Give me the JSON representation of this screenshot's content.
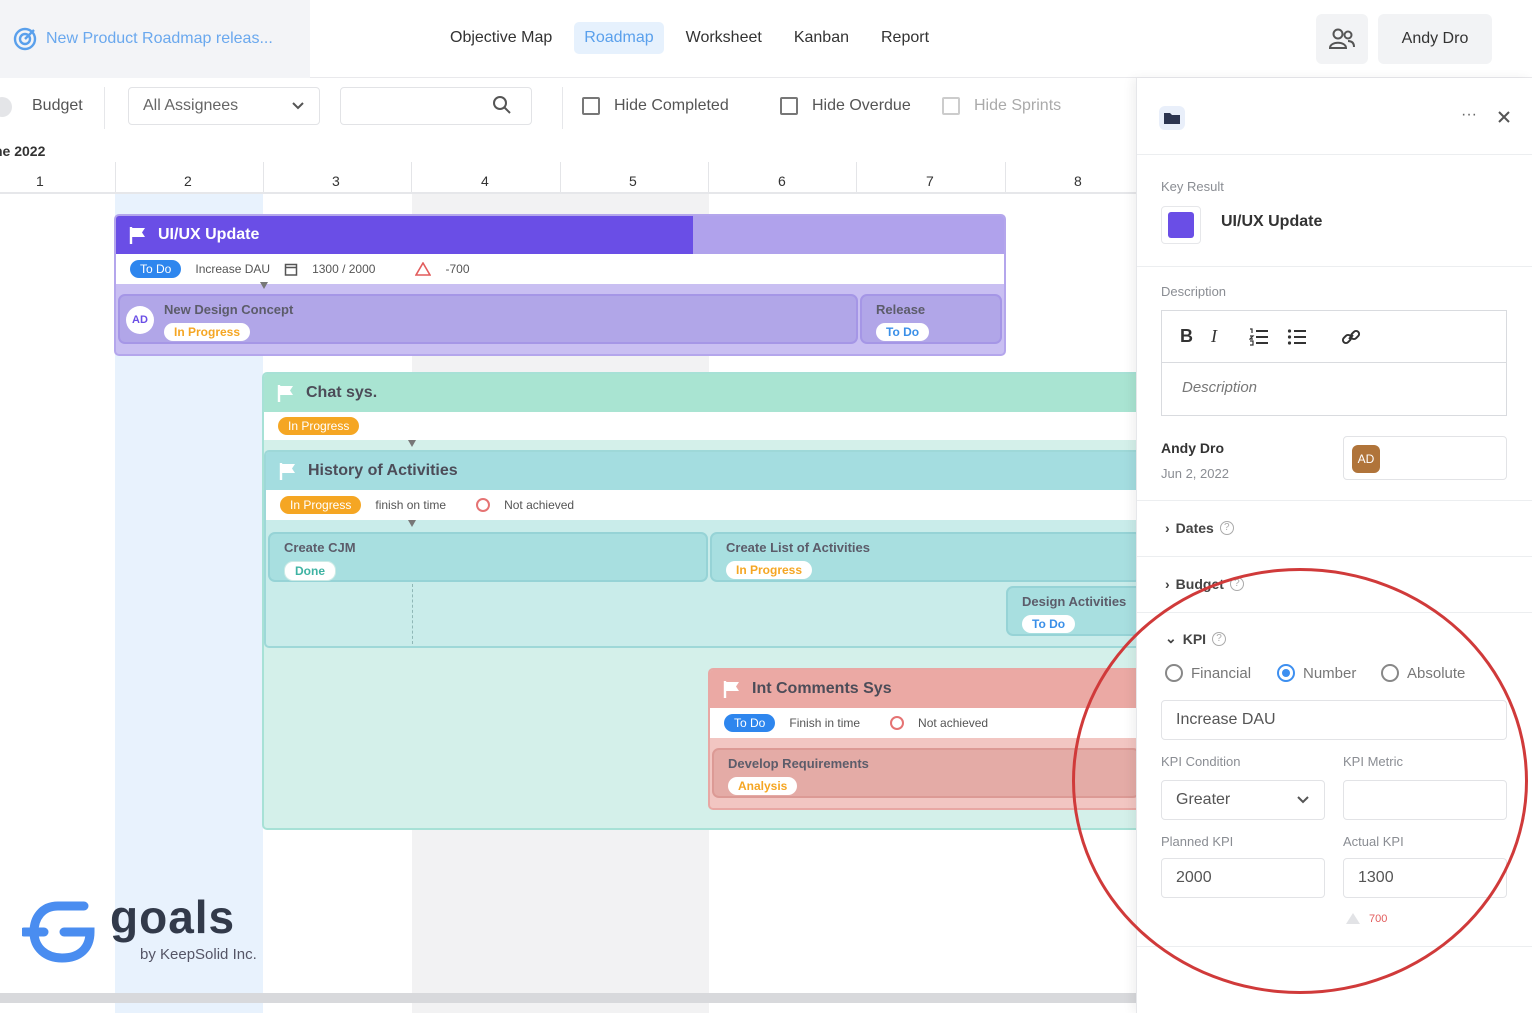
{
  "header": {
    "project_title": "New Product Roadmap releas...",
    "tabs": [
      {
        "label": "Objective Map"
      },
      {
        "label": "Roadmap",
        "active": true
      },
      {
        "label": "Worksheet"
      },
      {
        "label": "Kanban"
      },
      {
        "label": "Report"
      }
    ],
    "user_name": "Andy Dro"
  },
  "toolbar": {
    "budget_label": "Budget",
    "assignees_value": "All Assignees",
    "search_value": "",
    "hide_completed": "Hide Completed",
    "hide_overdue": "Hide Overdue",
    "hide_sprints": "Hide Sprints"
  },
  "timeline": {
    "month_label": "ne 2022",
    "columns": [
      "1",
      "2",
      "3",
      "4",
      "5",
      "6",
      "7",
      "8"
    ]
  },
  "objectives": {
    "uiux": {
      "title": "UI/UX Update",
      "status": "To Do",
      "kpi_name": "Increase DAU",
      "kpi_progress": "1300 / 2000",
      "kpi_diff": "-700",
      "progress": 0.65,
      "tasks": [
        {
          "avatar": "AD",
          "title": "New Design Concept",
          "status": "In Progress"
        },
        {
          "title": "Release",
          "status": "To Do"
        }
      ]
    },
    "chat": {
      "title": "Chat sys.",
      "status": "In Progress"
    },
    "history": {
      "title": "History of Activities",
      "status": "In Progress",
      "kpi_name": "finish on time",
      "kpi_state": "Not achieved",
      "tasks": [
        {
          "title": "Create CJM",
          "status": "Done"
        },
        {
          "title": "Create List of Activities",
          "status": "In Progress"
        },
        {
          "title": "Design Activities",
          "status": "To Do"
        }
      ]
    },
    "comments": {
      "title": "Int Comments Sys",
      "status": "To Do",
      "kpi_name": "Finish in time",
      "kpi_state": "Not achieved",
      "tasks": [
        {
          "title": "Develop Requirements",
          "status": "Analysis"
        }
      ]
    }
  },
  "panel": {
    "key_result_label": "Key Result",
    "title": "UI/UX Update",
    "color": "#6a4ee6",
    "description_label": "Description",
    "description_placeholder": "Description",
    "owner_name": "Andy Dro",
    "owner_date": "Jun 2, 2022",
    "owner_avatar": "AD",
    "dates_label": "Dates",
    "budget_label": "Budget",
    "kpi_label": "KPI",
    "kpi_types": [
      "Financial",
      "Number",
      "Absolute"
    ],
    "kpi_selected": "Number",
    "kpi_name_value": "Increase DAU",
    "kpi_condition_label": "KPI Condition",
    "kpi_condition_value": "Greater",
    "kpi_metric_label": "KPI Metric",
    "kpi_metric_value": "",
    "planned_label": "Planned KPI",
    "planned_value": "2000",
    "actual_label": "Actual KPI",
    "actual_value": "1300",
    "diff_value": "700"
  },
  "logo": {
    "word": "goals",
    "sub": "by KeepSolid Inc."
  }
}
